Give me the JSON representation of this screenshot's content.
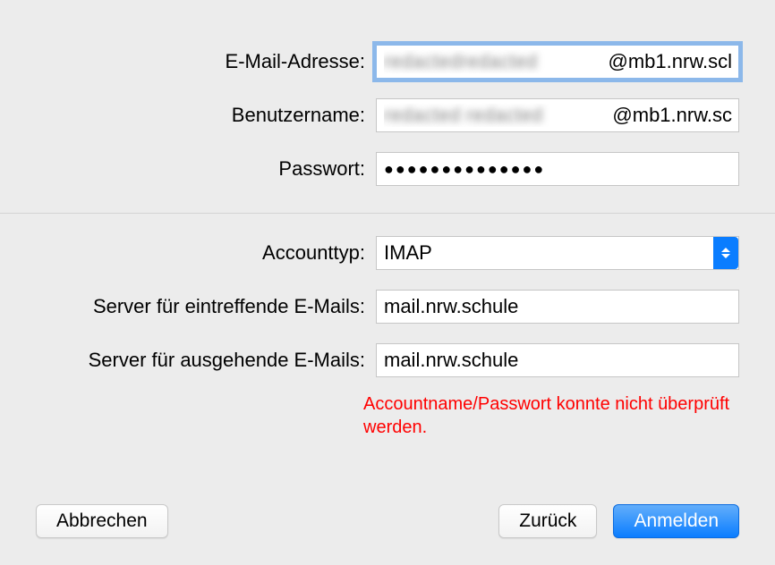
{
  "labels": {
    "email": "E-Mail-Adresse:",
    "username": "Benutzername:",
    "password": "Passwort:",
    "accountType": "Accounttyp:",
    "incomingServer": "Server für eintreffende E-Mails:",
    "outgoingServer": "Server für ausgehende E-Mails:"
  },
  "values": {
    "emailSuffix": "@mb1.nrw.scl",
    "usernameSuffix": "@mb1.nrw.sc",
    "passwordMasked": "●●●●●●●●●●●●●●",
    "accountType": "IMAP",
    "incomingServer": "mail.nrw.schule",
    "outgoingServer": "mail.nrw.schule"
  },
  "error": "Accountname/Passwort konnte nicht überprüft werden.",
  "buttons": {
    "cancel": "Abbrechen",
    "back": "Zurück",
    "signin": "Anmelden"
  }
}
